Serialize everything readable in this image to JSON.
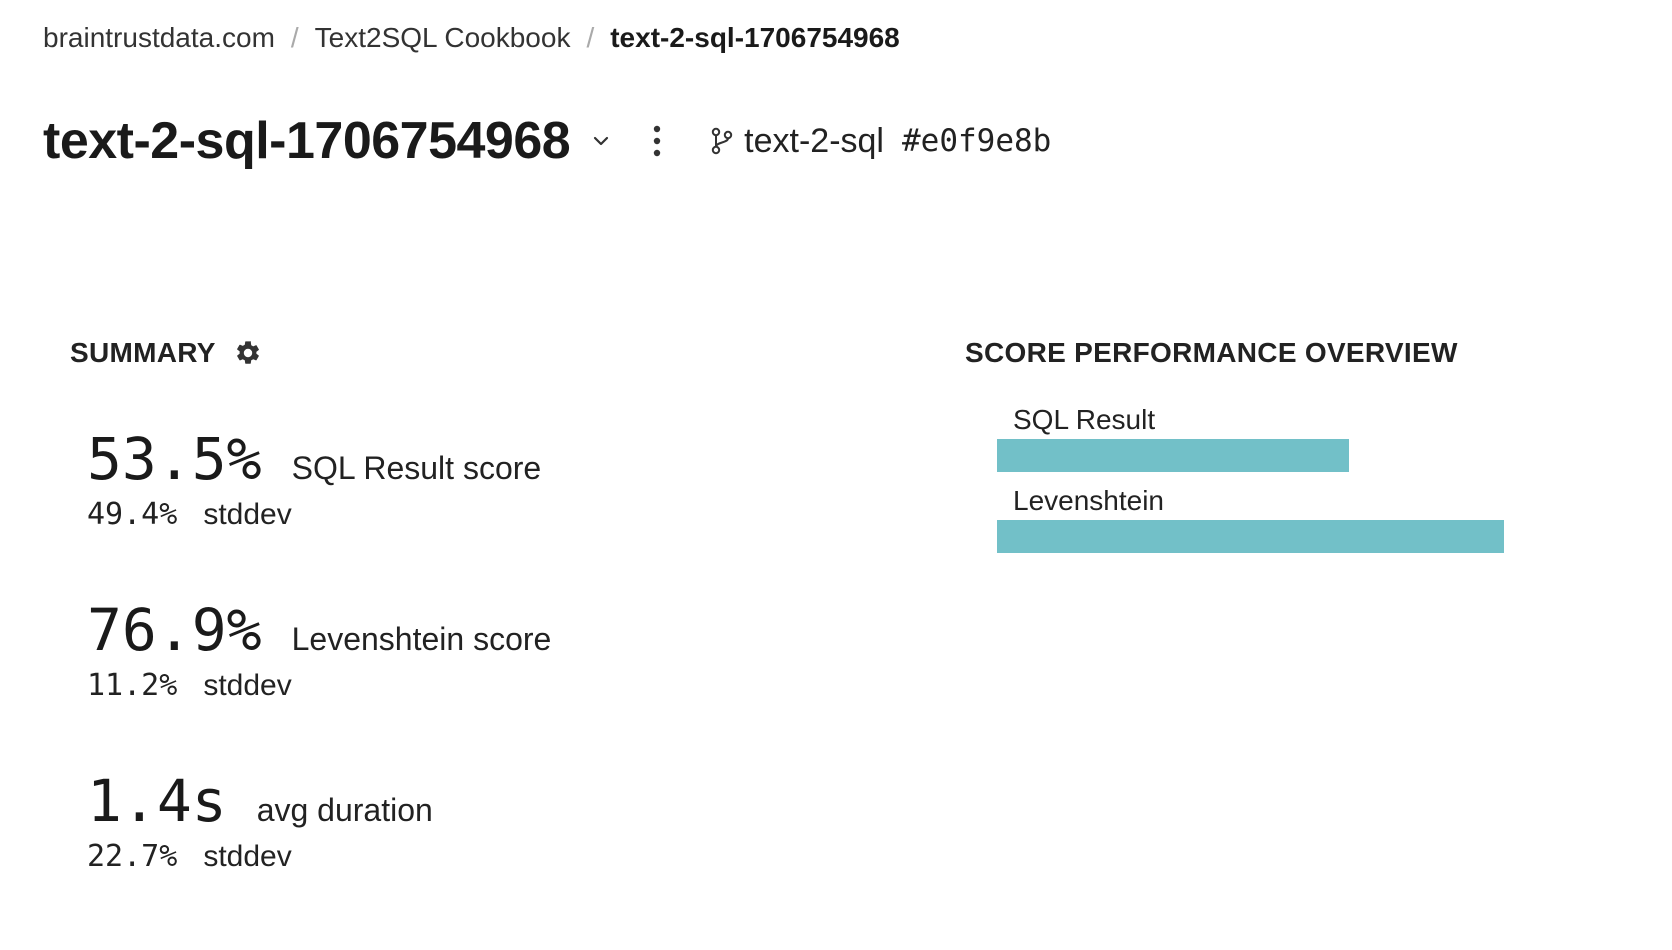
{
  "breadcrumb": {
    "items": [
      "braintrustdata.com",
      "Text2SQL Cookbook",
      "text-2-sql-1706754968"
    ],
    "separator": "/"
  },
  "header": {
    "experiment_name": "text-2-sql-1706754968",
    "branch": "text-2-sql",
    "commit": "#e0f9e8b"
  },
  "summary": {
    "heading": "SUMMARY",
    "metrics": [
      {
        "value": "53.5%",
        "label": "SQL Result score",
        "stddev": "49.4%",
        "stddev_label": "stddev"
      },
      {
        "value": "76.9%",
        "label": "Levenshtein score",
        "stddev": "11.2%",
        "stddev_label": "stddev"
      },
      {
        "value": "1.4s",
        "label": "avg duration",
        "stddev": "22.7%",
        "stddev_label": "stddev"
      }
    ]
  },
  "overview": {
    "heading": "SCORE PERFORMANCE OVERVIEW"
  },
  "chart_data": {
    "type": "bar",
    "orientation": "horizontal",
    "categories": [
      "SQL Result",
      "Levenshtein"
    ],
    "values": [
      0.535,
      0.769
    ],
    "xlim": [
      0,
      0.85
    ],
    "bar_color": "#72c0c8",
    "grid": false
  },
  "colors": {
    "bar": "#72c0c8",
    "text": "#222222",
    "separator": "#aaaaaa"
  }
}
